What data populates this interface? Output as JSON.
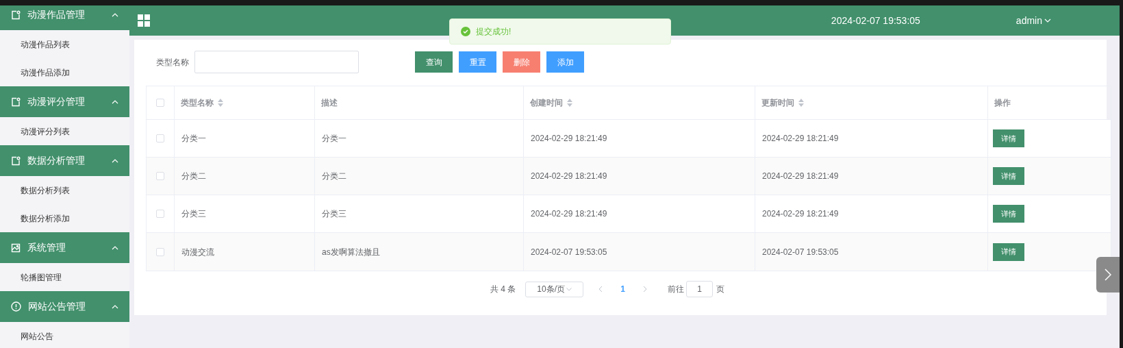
{
  "sidebar": {
    "groups": [
      {
        "label": "动漫作品管理",
        "kind": "doc",
        "expanded": true,
        "children": [
          {
            "label": "动漫作品列表"
          },
          {
            "label": "动漫作品添加"
          }
        ]
      },
      {
        "label": "动漫评分管理",
        "kind": "doc",
        "expanded": true,
        "children": [
          {
            "label": "动漫评分列表"
          }
        ]
      },
      {
        "label": "数据分析管理",
        "kind": "doc",
        "expanded": true,
        "children": [
          {
            "label": "数据分析列表"
          },
          {
            "label": "数据分析添加"
          }
        ]
      },
      {
        "label": "系统管理",
        "kind": "image",
        "expanded": true,
        "children": [
          {
            "label": "轮播图管理"
          }
        ]
      },
      {
        "label": "网站公告管理",
        "kind": "alert",
        "expanded": true,
        "children": [
          {
            "label": "网站公告"
          }
        ]
      }
    ]
  },
  "header": {
    "datetime": "2024-02-07 19:53:05",
    "user": "admin"
  },
  "toast": {
    "message": "提交成功!"
  },
  "search": {
    "label": "类型名称"
  },
  "buttons": [
    {
      "label": "查询",
      "kind": "query"
    },
    {
      "label": "重置",
      "kind": "reset"
    },
    {
      "label": "删除",
      "kind": "delete"
    },
    {
      "label": "添加",
      "kind": "add"
    }
  ],
  "table": {
    "all_checked": false,
    "columns": [
      {
        "label": "类型名称",
        "sortable": true
      },
      {
        "label": "描述",
        "sortable": false
      },
      {
        "label": "创建时间",
        "sortable": true
      },
      {
        "label": "更新时间",
        "sortable": true
      },
      {
        "label": "操作",
        "sortable": false
      }
    ],
    "rows": [
      {
        "checked": false,
        "name": "分类一",
        "desc": "分类一",
        "created": "2024-02-29 18:21:49",
        "updated": "2024-02-29 18:21:49",
        "action": "详情"
      },
      {
        "checked": false,
        "name": "分类二",
        "desc": "分类二",
        "created": "2024-02-29 18:21:49",
        "updated": "2024-02-29 18:21:49",
        "action": "详情"
      },
      {
        "checked": false,
        "name": "分类三",
        "desc": "分类三",
        "created": "2024-02-29 18:21:49",
        "updated": "2024-02-29 18:21:49",
        "action": "详情"
      },
      {
        "checked": false,
        "name": "动漫交流",
        "desc": "as发啊算法撤且",
        "created": "2024-02-07 19:53:05",
        "updated": "2024-02-07 19:53:05",
        "action": "详情"
      }
    ]
  },
  "pagination": {
    "total": "共 4 条",
    "page_size": "10条/页",
    "pages": [
      {
        "label": "1",
        "selected": true
      }
    ],
    "goto_label": "前往",
    "goto_value": "1",
    "goto_suffix": "页"
  }
}
